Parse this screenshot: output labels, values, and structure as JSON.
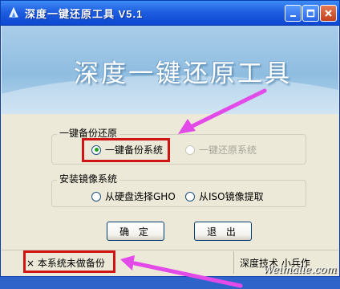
{
  "window": {
    "title": "深度一键还原工具  V5.1",
    "controls": [
      "minimize",
      "maximize",
      "close"
    ],
    "accent": "#0c48d2",
    "close_color": "#c2401d"
  },
  "banner": {
    "title": "深度一键还原工具"
  },
  "backup_group": {
    "label": "一键备份还原",
    "options": [
      {
        "label": "一键备份系统",
        "selected": true,
        "enabled": true
      },
      {
        "label": "一键还原系统",
        "selected": false,
        "enabled": false
      }
    ]
  },
  "install_group": {
    "label": "安装镜像系统",
    "options": [
      {
        "label": "从硬盘选择GHO",
        "selected": false
      },
      {
        "label": "从ISO镜像提取",
        "selected": false
      }
    ]
  },
  "buttons": {
    "confirm": "确 定",
    "exit": "退 出"
  },
  "status": {
    "icon": "×",
    "message": "本系统未做备份",
    "credit": "深度技术 小兵作"
  },
  "watermark": "Weimalie.com",
  "annotation": {
    "highlight_color": "#d01515",
    "arrow_color": "#e34be8"
  }
}
